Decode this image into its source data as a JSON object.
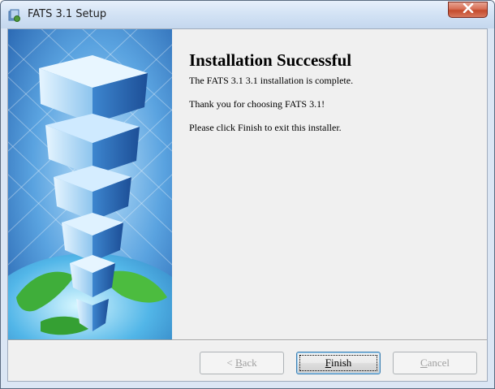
{
  "window": {
    "title": "FATS 3.1 Setup",
    "app_icon": "installer-icon",
    "close_icon": "close-icon"
  },
  "banner": {
    "icon": "skyscraper-globe-graphic"
  },
  "content": {
    "heading": "Installation Successful",
    "line1": "The FATS 3.1 3.1 installation is complete.",
    "line2": "Thank you for choosing FATS 3.1!",
    "line3": "Please click Finish to exit this installer."
  },
  "buttons": {
    "back": {
      "mnemonic": "B",
      "rest": "ack",
      "prefix": "< ",
      "enabled": false
    },
    "finish": {
      "mnemonic": "F",
      "rest": "inish",
      "enabled": true,
      "default": true
    },
    "cancel": {
      "mnemonic": "C",
      "rest": "ancel",
      "enabled": false
    }
  },
  "colors": {
    "titlebar": "#d4e3f5",
    "close_button": "#c44b2c",
    "banner_blue": "#2f6fb8",
    "dialog_bg": "#f0f0f0"
  }
}
